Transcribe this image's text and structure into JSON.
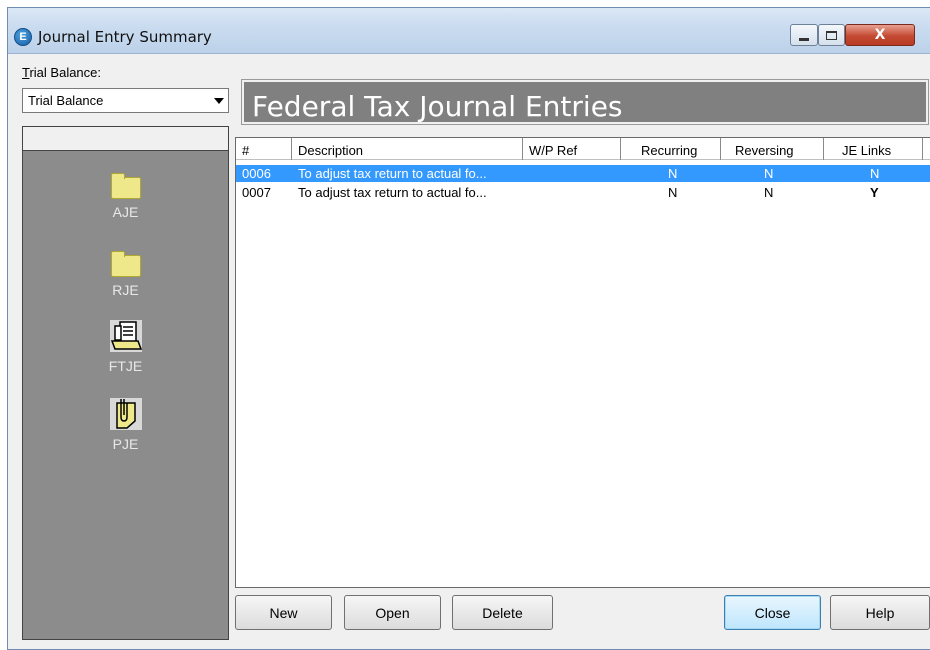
{
  "window": {
    "title": "Journal Entry Summary",
    "app_icon_letter": "E",
    "controls": {
      "minimize": "minimize-icon",
      "maximize": "maximize-icon",
      "close": "X"
    }
  },
  "trial_balance": {
    "label_first": "T",
    "label_rest": "rial Balance:",
    "selected": "Trial Balance"
  },
  "nav": {
    "items": [
      {
        "label": "AJE",
        "icon": "folder-icon"
      },
      {
        "label": "RJE",
        "icon": "folder-icon"
      },
      {
        "label": "FTJE",
        "icon": "open-folder-document-icon"
      },
      {
        "label": "PJE",
        "icon": "binder-clip-icon"
      }
    ],
    "active": "FTJE"
  },
  "banner": {
    "title": "Federal Tax Journal Entries"
  },
  "table": {
    "columns": [
      "#",
      "Description",
      "W/P Ref",
      "Recurring",
      "Reversing",
      "JE Links"
    ],
    "rows": [
      {
        "num": "0006",
        "description": "To adjust tax return to actual fo...",
        "wp_ref": "",
        "recurring": "N",
        "reversing": "N",
        "je_links": "N",
        "selected": true
      },
      {
        "num": "0007",
        "description": "To adjust tax return to actual fo...",
        "wp_ref": "",
        "recurring": "N",
        "reversing": "N",
        "je_links": "Y",
        "selected": false
      }
    ]
  },
  "buttons": {
    "new": "New",
    "open": "Open",
    "delete": "Delete",
    "close": "Close",
    "help": "Help"
  },
  "colors": {
    "selection": "#3399ff",
    "banner": "#808080",
    "left_panel": "#8c8c8c",
    "folder": "#eee88a"
  }
}
